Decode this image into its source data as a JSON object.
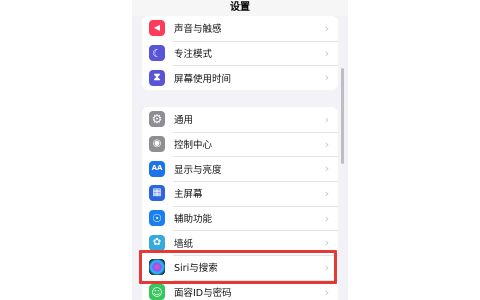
{
  "nav": {
    "title": "设置"
  },
  "group1": {
    "items": [
      {
        "label": "声音与触感",
        "icon": "speaker-icon",
        "color": "#ff3b5c",
        "glyph": "◀"
      },
      {
        "label": "专注模式",
        "icon": "moon-icon",
        "color": "#5856d6",
        "glyph": "☾"
      },
      {
        "label": "屏幕使用时间",
        "icon": "hourglass-icon",
        "color": "#5856d6",
        "glyph": "⧗"
      }
    ]
  },
  "group2": {
    "items": [
      {
        "label": "通用",
        "icon": "gear-icon",
        "color": "#8e8e93",
        "glyph": "⚙"
      },
      {
        "label": "控制中心",
        "icon": "control-center-icon",
        "color": "#8e8e93",
        "glyph": "◉"
      },
      {
        "label": "显示与亮度",
        "icon": "display-brightness-icon",
        "color": "#1d73e8",
        "glyph": "AA"
      },
      {
        "label": "主屏幕",
        "icon": "home-screen-icon",
        "color": "#2d63e0",
        "glyph": "▦"
      },
      {
        "label": "辅助功能",
        "icon": "accessibility-icon",
        "color": "#1a7ff0",
        "glyph": "☉"
      },
      {
        "label": "墙纸",
        "icon": "wallpaper-icon",
        "color": "#36aadc",
        "glyph": "✿"
      },
      {
        "label": "Siri与搜索",
        "icon": "siri-icon",
        "color": "#1c1c2e",
        "glyph": "●"
      },
      {
        "label": "面容ID与密码",
        "icon": "face-id-icon",
        "color": "#34c759",
        "glyph": "☺"
      }
    ]
  },
  "chevron": "›",
  "highlight_color": "#e53935"
}
